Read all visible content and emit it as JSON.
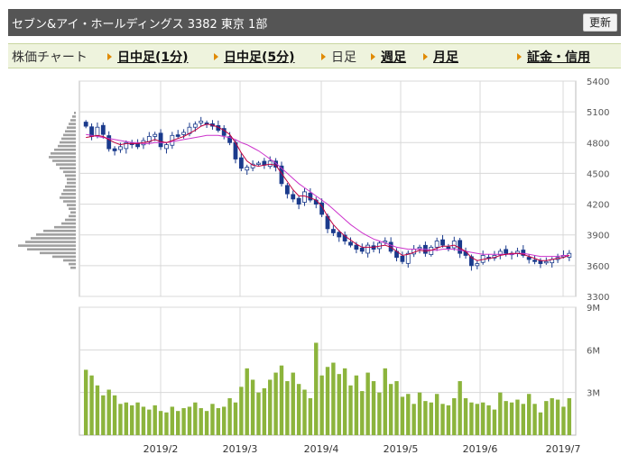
{
  "header": {
    "title": "セブン&アイ・ホールディングス  3382  東京 1部",
    "refresh_label": "更新"
  },
  "tabs": {
    "label": "株価チャート",
    "items": [
      {
        "label": "日中足(1分)",
        "link": true
      },
      {
        "label": "日中足(5分)",
        "link": true
      },
      {
        "label": "日足",
        "link": false
      },
      {
        "label": "週足",
        "link": true
      },
      {
        "label": "月足",
        "link": true
      },
      {
        "label": "証金・信用",
        "link": true
      }
    ]
  },
  "colors": {
    "price_up": "#ffffff",
    "price_down": "#1a3a8c",
    "ma_short": "#c00040",
    "ma_long": "#cc33cc",
    "volume_bar": "#8cb43c",
    "grid": "#d8d8d8"
  },
  "chart_data": [
    {
      "type": "candlestick",
      "y_ticks": [
        "5400",
        "5100",
        "4800",
        "4500",
        "4200",
        "3900",
        "3600",
        "3300"
      ],
      "ylim": [
        3300,
        5400
      ],
      "x_ticks": [
        "2019/2",
        "2019/3",
        "2019/4",
        "2019/5",
        "2019/6",
        "2019/7"
      ],
      "closes": [
        4960,
        4860,
        4950,
        4880,
        4740,
        4720,
        4760,
        4800,
        4780,
        4760,
        4820,
        4860,
        4880,
        4760,
        4780,
        4870,
        4860,
        4900,
        4950,
        4980,
        5010,
        4990,
        4960,
        4920,
        4870,
        4800,
        4640,
        4550,
        4560,
        4590,
        4600,
        4580,
        4620,
        4560,
        4400,
        4300,
        4250,
        4200,
        4320,
        4240,
        4200,
        4100,
        3960,
        3920,
        3880,
        3840,
        3800,
        3760,
        3740,
        3800,
        3760,
        3820,
        3840,
        3740,
        3680,
        3640,
        3720,
        3760,
        3780,
        3720,
        3780,
        3840,
        3800,
        3780,
        3840,
        3720,
        3700,
        3600,
        3620,
        3700,
        3680,
        3700,
        3740,
        3720,
        3720,
        3740,
        3700,
        3660,
        3640,
        3620,
        3640,
        3660,
        3680,
        3700,
        3720
      ],
      "ma_short": [
        4850,
        4860,
        4870,
        4860,
        4830,
        4800,
        4780,
        4790,
        4790,
        4790,
        4800,
        4810,
        4830,
        4810,
        4800,
        4820,
        4840,
        4860,
        4890,
        4920,
        4960,
        4980,
        4970,
        4950,
        4920,
        4880,
        4800,
        4700,
        4620,
        4580,
        4570,
        4580,
        4590,
        4580,
        4500,
        4420,
        4340,
        4280,
        4280,
        4260,
        4240,
        4180,
        4080,
        4000,
        3940,
        3890,
        3850,
        3810,
        3780,
        3780,
        3780,
        3790,
        3800,
        3780,
        3740,
        3700,
        3710,
        3730,
        3750,
        3740,
        3750,
        3770,
        3790,
        3790,
        3800,
        3770,
        3740,
        3680,
        3650,
        3660,
        3670,
        3680,
        3700,
        3710,
        3720,
        3720,
        3710,
        3690,
        3670,
        3650,
        3650,
        3660,
        3670,
        3680,
        3700
      ],
      "ma_long": [
        4880,
        4870,
        4860,
        4850,
        4840,
        4830,
        4820,
        4810,
        4800,
        4800,
        4790,
        4790,
        4800,
        4800,
        4800,
        4810,
        4820,
        4830,
        4840,
        4850,
        4860,
        4870,
        4870,
        4870,
        4860,
        4850,
        4830,
        4800,
        4780,
        4750,
        4720,
        4680,
        4640,
        4600,
        4550,
        4500,
        4450,
        4400,
        4360,
        4320,
        4280,
        4240,
        4200,
        4150,
        4100,
        4050,
        4000,
        3960,
        3920,
        3890,
        3860,
        3840,
        3820,
        3800,
        3780,
        3770,
        3760,
        3760,
        3760,
        3760,
        3750,
        3750,
        3760,
        3760,
        3760,
        3750,
        3740,
        3730,
        3720,
        3710,
        3710,
        3710,
        3710,
        3710,
        3710,
        3720,
        3720,
        3710,
        3700,
        3690,
        3690,
        3690,
        3690,
        3700,
        3700
      ],
      "volume_ylim": [
        0,
        9
      ],
      "volume_ticks": [
        "9M",
        "6M",
        "3M"
      ],
      "volumes": [
        4.6,
        4.2,
        3.5,
        2.8,
        3.2,
        2.8,
        2.2,
        2.3,
        2.1,
        2.3,
        2.0,
        1.8,
        2.1,
        1.7,
        1.6,
        2.0,
        1.7,
        1.9,
        2.0,
        2.3,
        1.9,
        1.7,
        2.2,
        1.9,
        2.0,
        2.6,
        2.3,
        3.4,
        4.7,
        3.9,
        3.0,
        3.3,
        3.9,
        4.4,
        4.9,
        3.8,
        4.4,
        3.6,
        3.2,
        2.6,
        6.5,
        4.2,
        4.8,
        5.1,
        4.3,
        4.7,
        3.5,
        4.2,
        3.1,
        4.4,
        3.8,
        3.0,
        4.7,
        3.6,
        3.8,
        2.7,
        2.9,
        2.2,
        3.0,
        2.4,
        2.3,
        2.9,
        2.2,
        2.1,
        2.6,
        3.8,
        2.6,
        2.3,
        2.2,
        2.3,
        2.1,
        1.8,
        3.0,
        2.4,
        2.3,
        2.5,
        2.2,
        2.9,
        2.2,
        1.6,
        2.4,
        2.6,
        2.5,
        2.0,
        2.6
      ]
    }
  ]
}
